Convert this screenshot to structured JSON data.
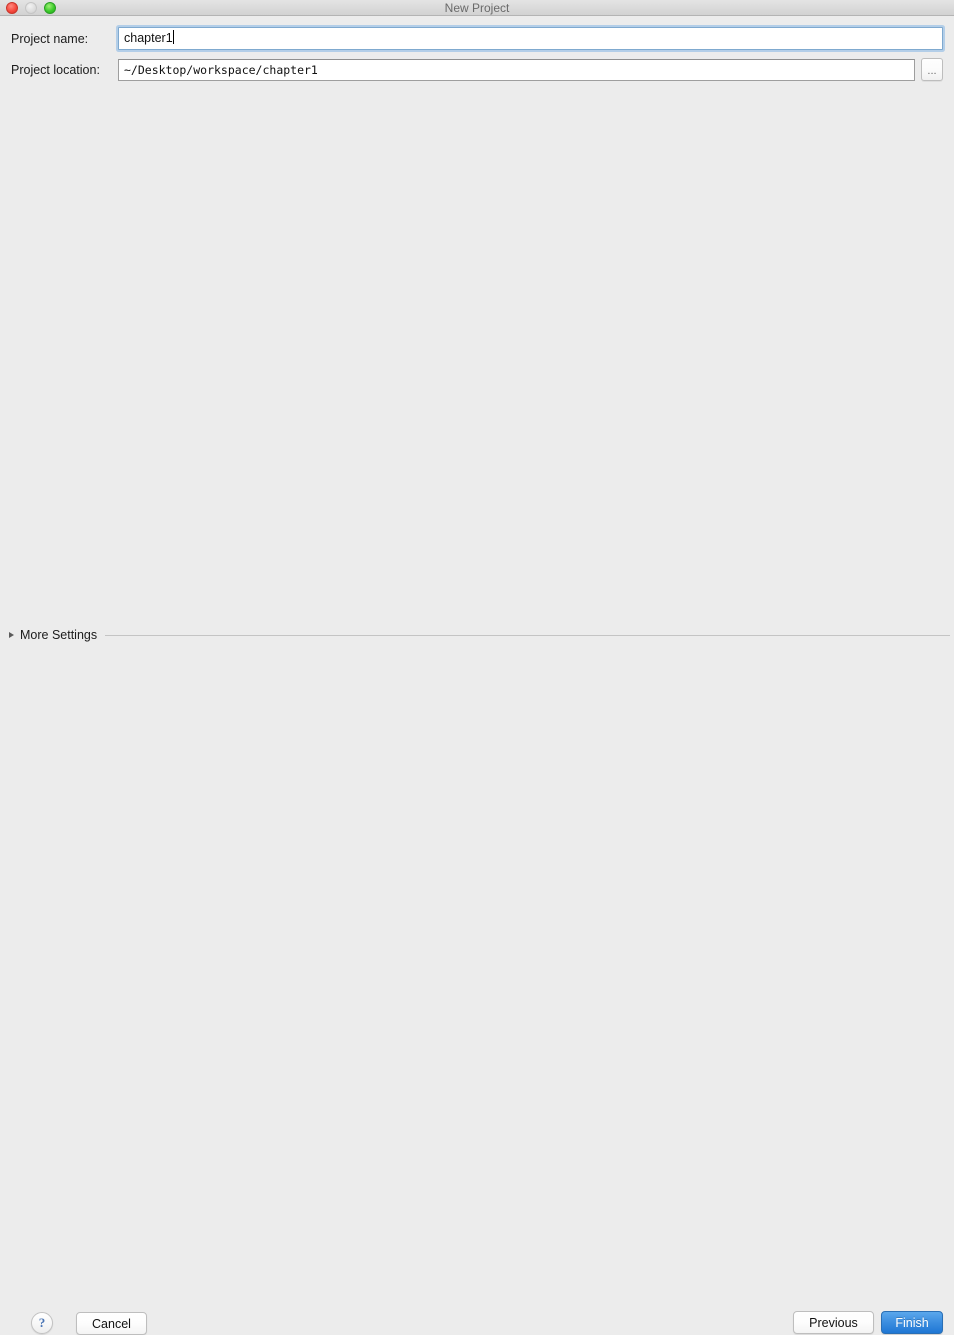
{
  "window": {
    "title": "New Project",
    "controls": {
      "close": "close-button",
      "minimize": "minimize-button",
      "zoom": "zoom-button"
    }
  },
  "form": {
    "project_name": {
      "label": "Project name:",
      "value": "chapter1",
      "placeholder": ""
    },
    "project_location": {
      "label": "Project location:",
      "value": "~/Desktop/workspace/chapter1",
      "placeholder": "",
      "browse_label": "..."
    }
  },
  "more_settings": {
    "label": "More Settings",
    "expanded": false,
    "triangle": "chevron-right-icon"
  },
  "footer": {
    "help_label": "?",
    "cancel_label": "Cancel",
    "previous_label": "Previous",
    "finish_label": "Finish"
  },
  "colors": {
    "background": "#ececec",
    "titlebar_top": "#e4e4e4",
    "titlebar_bottom": "#d2d2d2",
    "accent_blue": "#3c8ee0",
    "focus_ring": "#7ab0e3",
    "close_red": "#f64a3f",
    "minimize_gray": "#dcdcdc",
    "zoom_green": "#3ccb2b",
    "help_glyph": "#4b76b5"
  }
}
